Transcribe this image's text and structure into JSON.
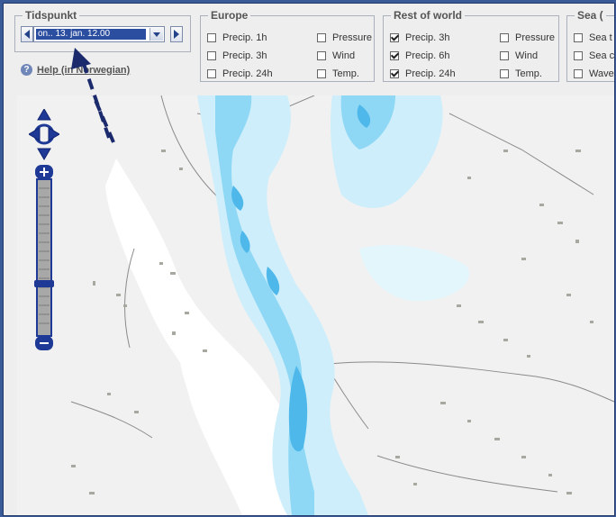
{
  "tidspunkt": {
    "legend": "Tidspunkt",
    "selected_time": "on.. 13. jan. 12.00"
  },
  "help_link": "Help (in Norwegian)",
  "europe": {
    "legend": "Europe",
    "options": [
      {
        "label": "Precip. 1h",
        "checked": false
      },
      {
        "label": "Precip. 3h",
        "checked": false
      },
      {
        "label": "Precip. 24h",
        "checked": false
      },
      {
        "label": "Pressure",
        "checked": false
      },
      {
        "label": "Wind",
        "checked": false
      },
      {
        "label": "Temp.",
        "checked": false
      }
    ]
  },
  "rest_of_world": {
    "legend": "Rest of world",
    "options": [
      {
        "label": "Precip. 3h",
        "checked": true
      },
      {
        "label": "Precip. 6h",
        "checked": true
      },
      {
        "label": "Precip. 24h",
        "checked": true
      },
      {
        "label": "Pressure",
        "checked": false
      },
      {
        "label": "Wind",
        "checked": false
      },
      {
        "label": "Temp.",
        "checked": false
      }
    ]
  },
  "sea": {
    "legend": "Sea (",
    "options": [
      {
        "label": "Sea t",
        "checked": false
      },
      {
        "label": "Sea c",
        "checked": false
      },
      {
        "label": "Wave",
        "checked": false
      }
    ]
  },
  "colors": {
    "accent": "#24428a",
    "frame": "#3a5a98",
    "land": "#f1f1f1",
    "water": "#ffffff",
    "lakes": "#a8a8a0",
    "precip_light": "#cdeefa",
    "precip_mid": "#8fd8f5",
    "precip_heavy": "#4fb8ea"
  }
}
